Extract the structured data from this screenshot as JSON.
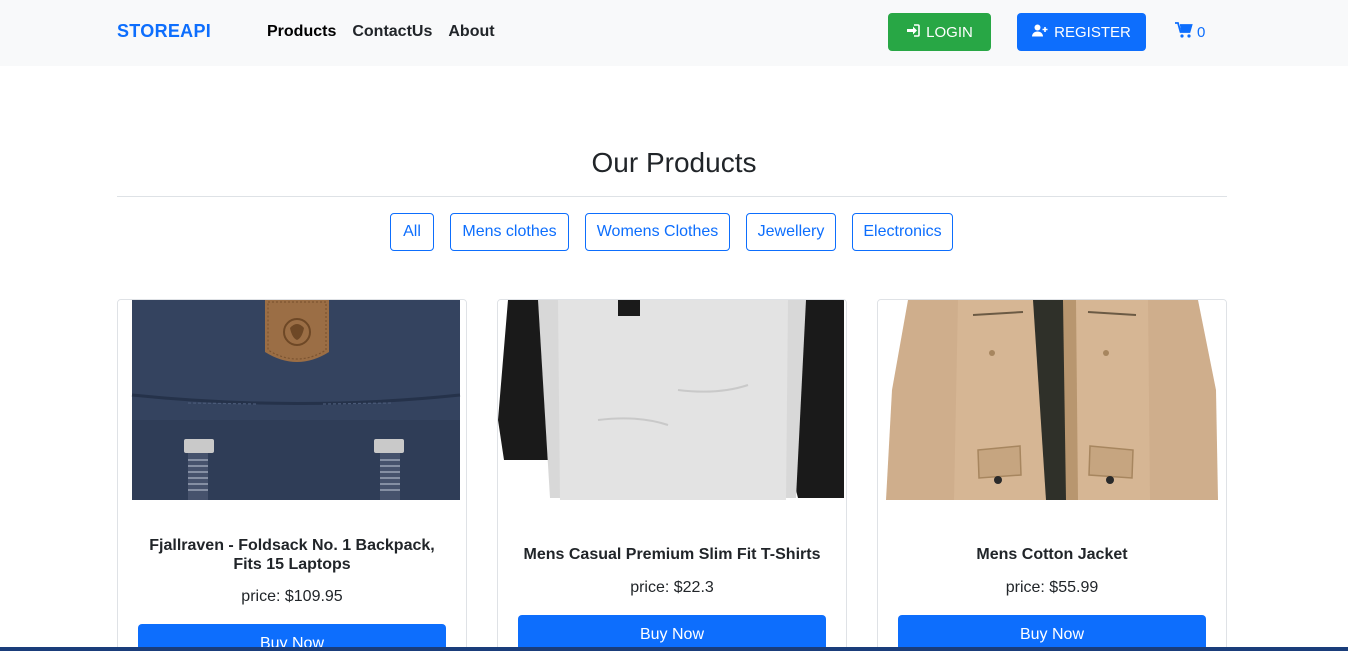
{
  "nav": {
    "brand": "STOREAPI",
    "links": [
      "Products",
      "ContactUs",
      "About"
    ],
    "login_label": "LOGIN",
    "register_label": "REGISTER",
    "cart_count": "0"
  },
  "main": {
    "title": "Our Products",
    "filters": [
      "All",
      "Mens clothes",
      "Womens Clothes",
      "Jewellery",
      "Electronics"
    ]
  },
  "products": [
    {
      "title": "Fjallraven - Foldsack No. 1 Backpack, Fits 15 Laptops",
      "price": "price: $109.95",
      "button": "Buy Now"
    },
    {
      "title": "Mens Casual Premium Slim Fit T-Shirts",
      "price": "price: $22.3",
      "button": "Buy Now"
    },
    {
      "title": "Mens Cotton Jacket",
      "price": "price: $55.99",
      "button": "Buy Now"
    }
  ],
  "colors": {
    "primary": "#0d6efd",
    "success": "#28a745",
    "navbar_bg": "#f8f9fa"
  }
}
